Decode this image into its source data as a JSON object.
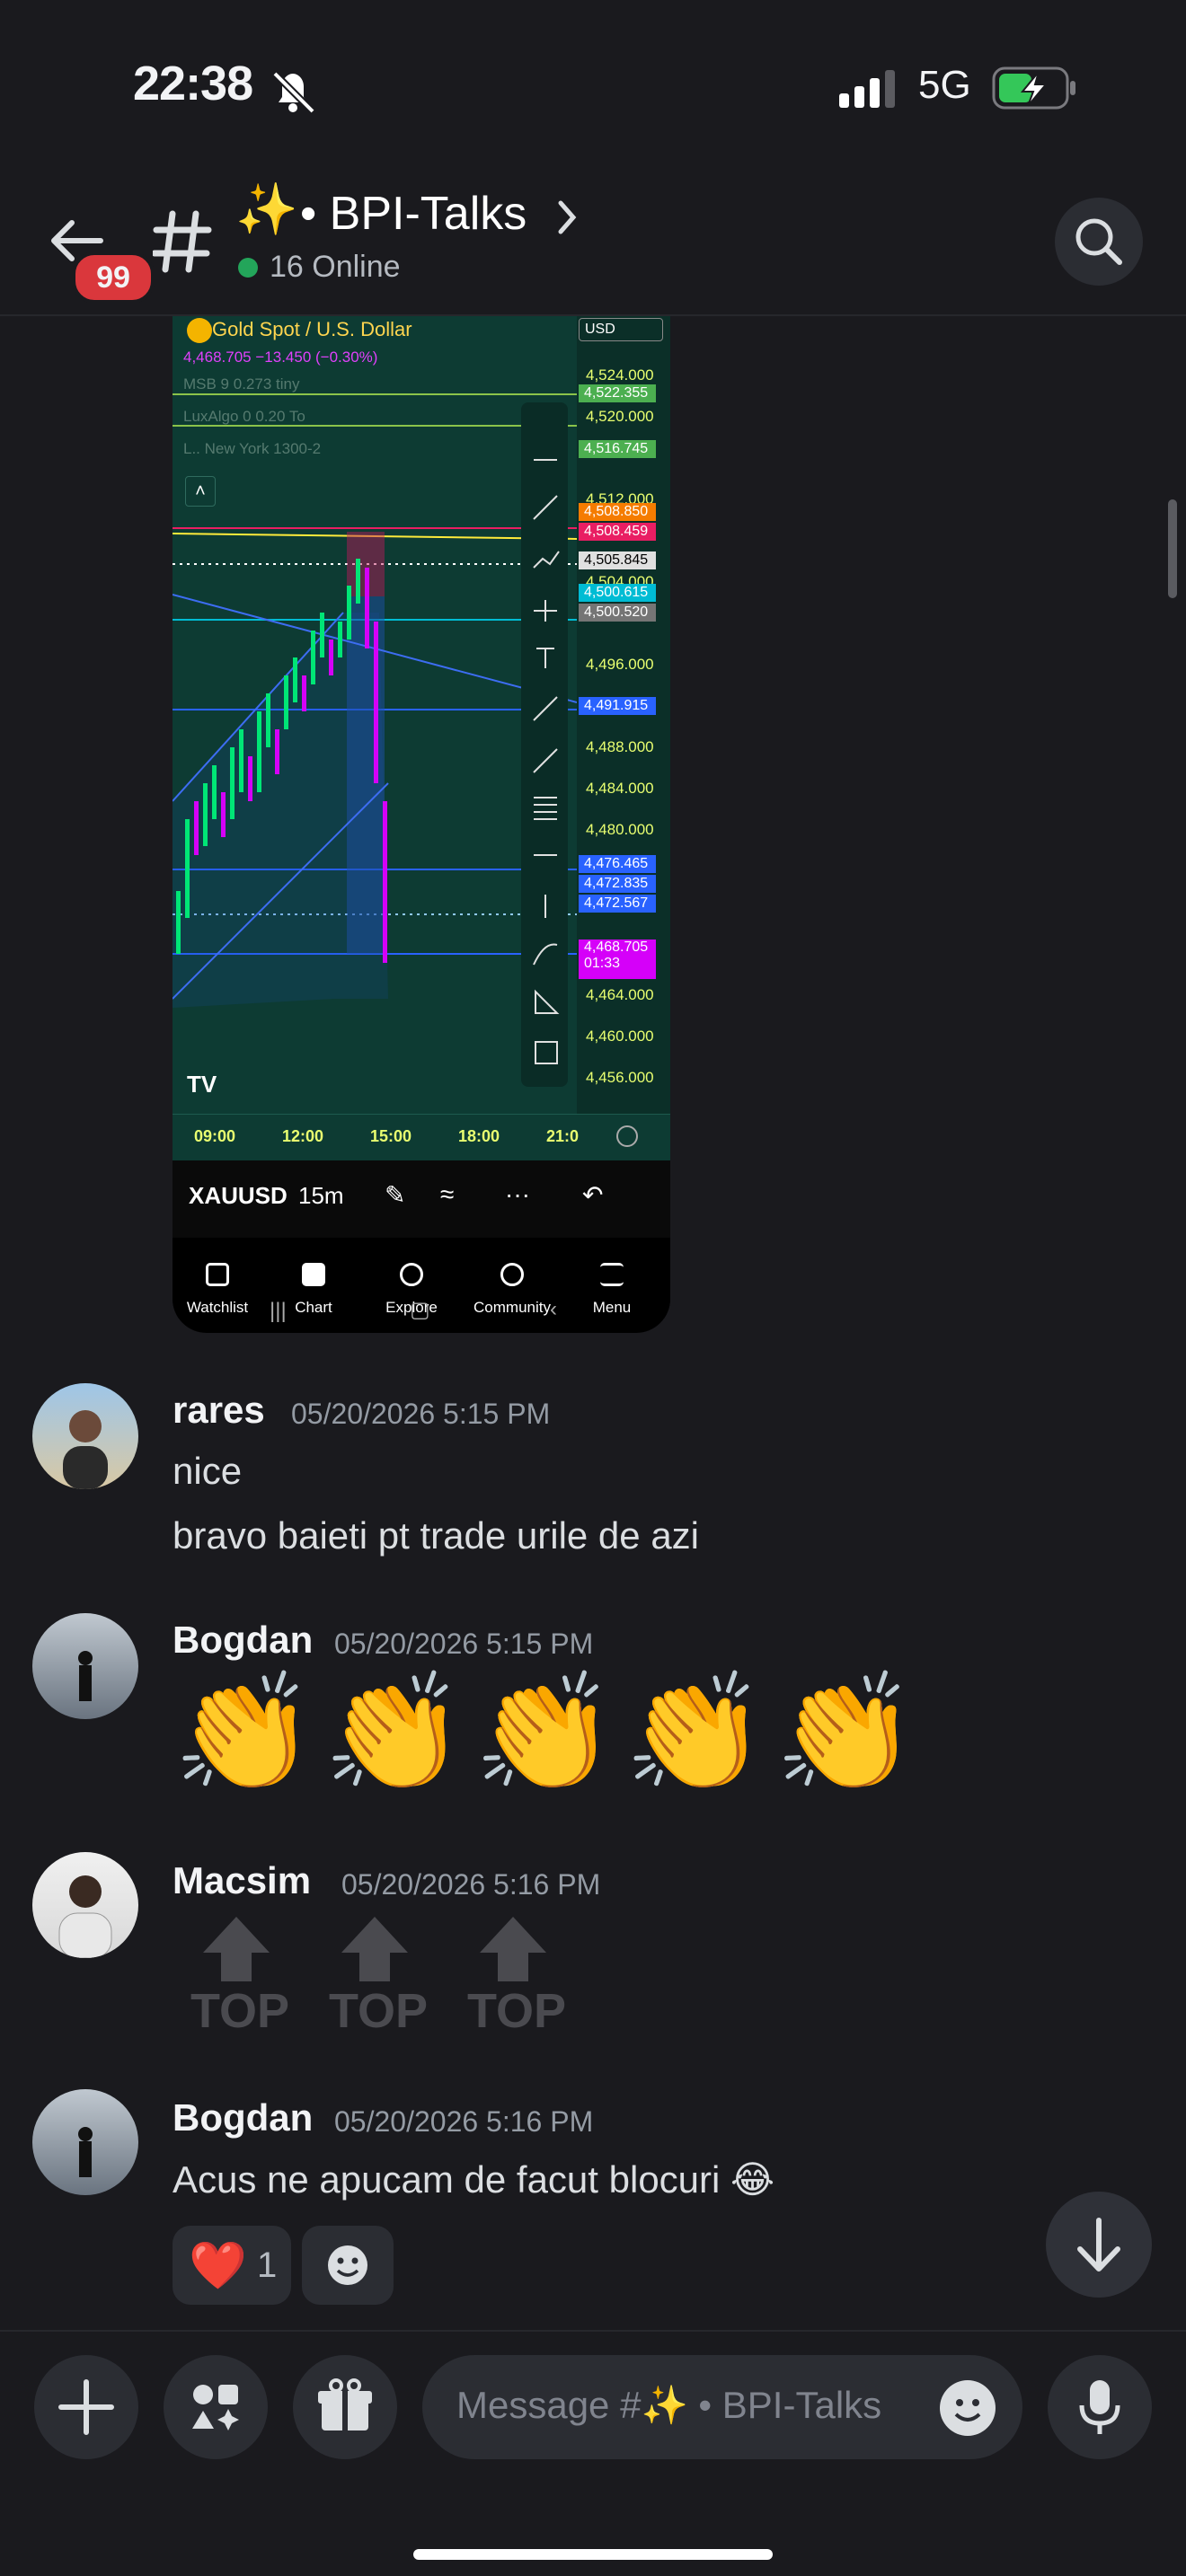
{
  "status_bar": {
    "time": "22:38",
    "network": "5G"
  },
  "header": {
    "back_badge": "99",
    "channel_emoji": "✨",
    "channel_name": "• BPI-Talks",
    "online": "16 Online"
  },
  "chart_attachment": {
    "symbol": "Gold Spot / U.S. Dollar",
    "quote": "4,468.705 −13.450 (−0.30%)",
    "indicators": [
      "MSB 9 0.273 tiny",
      "LuxAlgo 0 0.20 To",
      "L.. New York 1300-2"
    ],
    "currency": "USD",
    "price_labels": [
      "4,524.000",
      "4,520.000",
      "4,512.000",
      "4,504.000",
      "4,496.000",
      "4,488.000",
      "4,484.000",
      "4,480.000",
      "4,464.000",
      "4,460.000",
      "4,456.000"
    ],
    "price_tags": [
      {
        "value": "4,522.355",
        "color": "#4caf50"
      },
      {
        "value": "4,516.745",
        "color": "#4caf50"
      },
      {
        "value": "4,508.850",
        "color": "#f57c00"
      },
      {
        "value": "4,508.459",
        "color": "#e91e63"
      },
      {
        "value": "4,505.845",
        "color": "#e0e0e0"
      },
      {
        "value": "4,500.615",
        "color": "#00bcd4"
      },
      {
        "value": "4,500.520",
        "color": "#757575"
      },
      {
        "value": "4,491.915",
        "color": "#2962ff"
      },
      {
        "value": "4,476.465",
        "color": "#2962ff"
      },
      {
        "value": "4,472.835",
        "color": "#2962ff"
      },
      {
        "value": "4,472.567",
        "color": "#2962ff"
      }
    ],
    "last_price": "4,468.705",
    "countdown": "01:33",
    "time_labels": [
      "09:00",
      "12:00",
      "15:00",
      "18:00",
      "21:0"
    ],
    "toolbar": {
      "symbol": "XAUUSD",
      "interval": "15m"
    },
    "bottom_nav": [
      "Watchlist",
      "Chart",
      "Explore",
      "Community",
      "Menu"
    ]
  },
  "messages": [
    {
      "author": "rares",
      "timestamp": "05/20/2026 5:15 PM",
      "lines": [
        "nice",
        "bravo baieti pt trade urile de azi"
      ]
    },
    {
      "author": "Bogdan",
      "timestamp": "05/20/2026 5:15 PM",
      "emoji": "👏👏👏👏👏"
    },
    {
      "author": "Macsim",
      "timestamp": "05/20/2026 5:16 PM",
      "stickers": [
        "TOP",
        "TOP",
        "TOP"
      ]
    },
    {
      "author": "Bogdan",
      "timestamp": "05/20/2026 5:16 PM",
      "text": "Acus ne apucam de facut blocuri 😂",
      "reaction": {
        "emoji": "❤️",
        "count": "1"
      }
    }
  ],
  "composer": {
    "placeholder": "Message #✨ • BPI-Talks"
  }
}
